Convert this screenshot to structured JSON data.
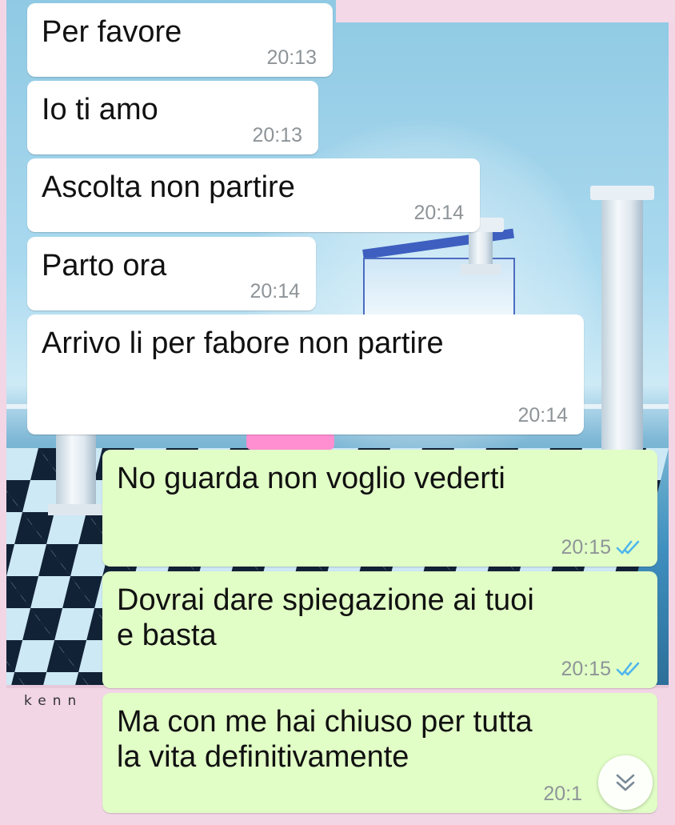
{
  "wallpaper": {
    "signature_text": "kenn"
  },
  "messages": [
    {
      "direction": "in",
      "text": "Per favore",
      "time": "20:13"
    },
    {
      "direction": "in",
      "text": "Io ti amo",
      "time": "20:13"
    },
    {
      "direction": "in",
      "text": "Ascolta non partire",
      "time": "20:14"
    },
    {
      "direction": "in",
      "text": "Parto ora",
      "time": "20:14"
    },
    {
      "direction": "in",
      "text": "Arrivo li per fabore non partire",
      "time": "20:14"
    },
    {
      "direction": "out",
      "text": "No guarda non voglio vederti",
      "time": "20:15",
      "status": "read"
    },
    {
      "direction": "out",
      "text": "Dovrai dare spiegazione ai tuoi\ne basta",
      "time": "20:15",
      "status": "read"
    },
    {
      "direction": "out",
      "text": "Ma con me hai chiuso per tutta\nla vita definitivamente",
      "time": "20:1",
      "status": "read"
    }
  ],
  "colors": {
    "incoming_bubble": "#ffffff",
    "outgoing_bubble": "#e1fec6",
    "read_ticks": "#4fb6ec",
    "timestamp": "#8e9498"
  },
  "icons": {
    "read_receipt": "double-check-icon",
    "scroll_down": "chevron-double-down-icon"
  }
}
